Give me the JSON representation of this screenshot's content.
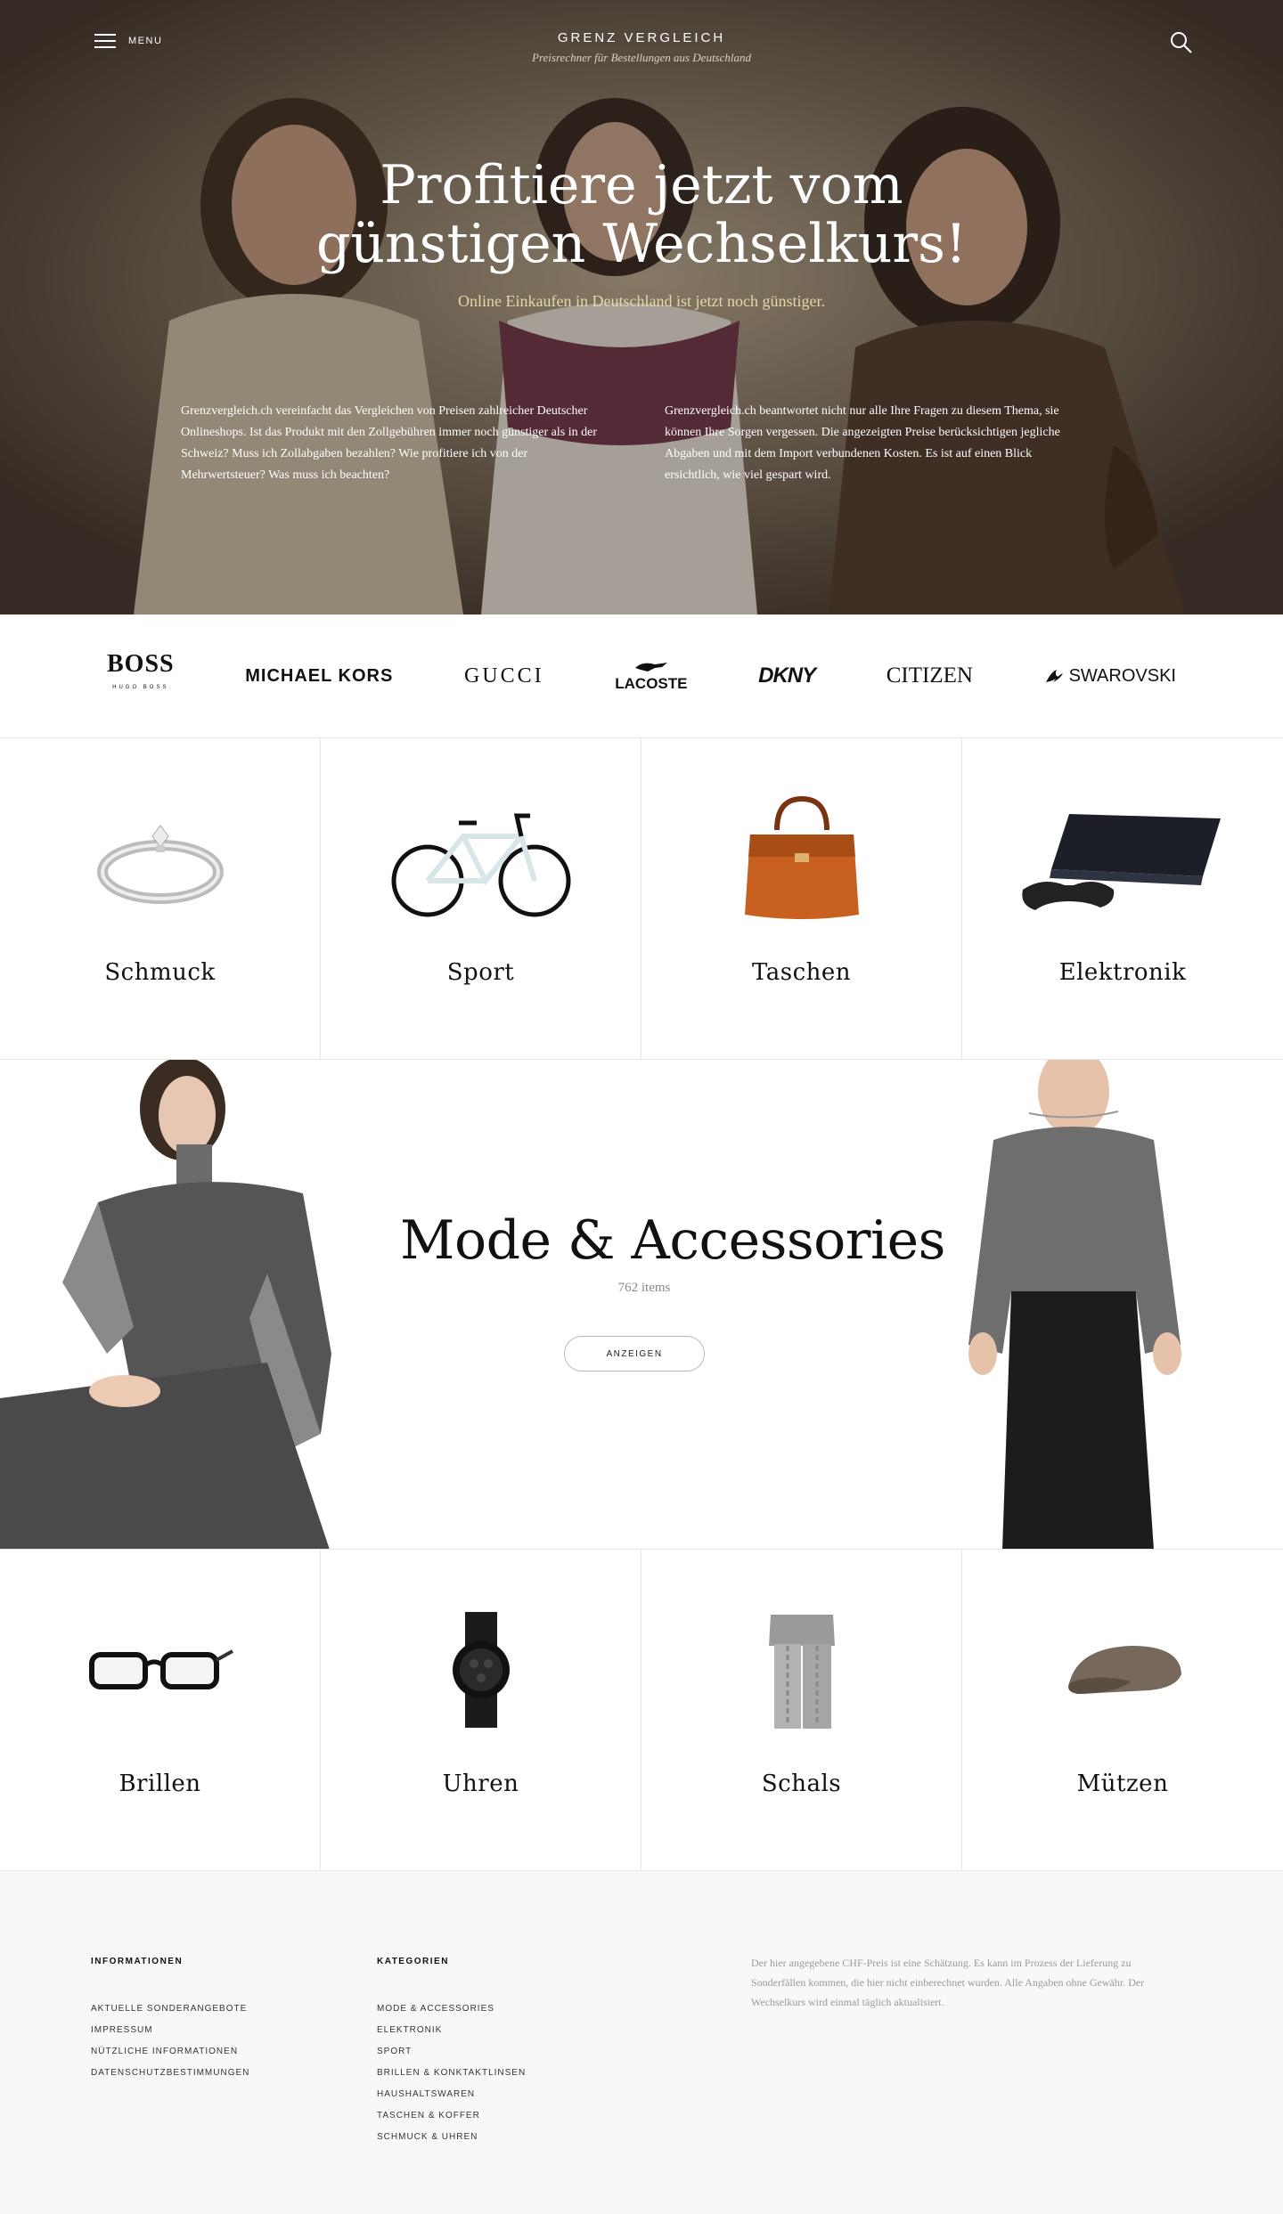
{
  "header": {
    "menu_label": "MENU",
    "brand_title": "GRENZ VERGLEICH",
    "brand_subtitle": "Preisrechner für Bestellungen aus Deutschland"
  },
  "hero": {
    "title_line1": "Profitiere jetzt vom",
    "title_line2": "günstigen Wechselkurs!",
    "subtitle": "Online Einkaufen in Deutschland ist jetzt noch günstiger.",
    "text_left": "Grenzvergleich.ch vereinfacht das Vergleichen von Preisen zahlreicher Deutscher Onlineshops. Ist das Produkt mit den Zollgebühren immer noch günstiger als in der Schweiz? Muss ich Zollabgaben bezahlen? Wie profitiere ich von der Mehrwertsteuer?  Was muss ich beachten?",
    "text_right": "Grenzvergleich.ch beantwortet nicht nur alle Ihre Fragen zu diesem Thema, sie können Ihre Sorgen vergessen. Die angezeigten Preise berücksichtigen jegliche Abgaben und mit dem Import verbundenen Kosten. Es ist auf einen Blick ersichtlich, wie viel gespart wird."
  },
  "brands": {
    "boss": "BOSS",
    "boss_small": "HUGO BOSS",
    "michael_kors": "MICHAEL KORS",
    "gucci": "GUCCI",
    "lacoste": "LACOSTE",
    "dkny": "DKNY",
    "citizen": "CITIZEN",
    "swarovski": "SWAROVSKI"
  },
  "categories_top": [
    {
      "label": "Schmuck",
      "icon": "ring-icon"
    },
    {
      "label": "Sport",
      "icon": "bicycle-icon"
    },
    {
      "label": "Taschen",
      "icon": "bag-icon"
    },
    {
      "label": "Elektronik",
      "icon": "console-icon"
    }
  ],
  "feature": {
    "title": "Mode & Accessories",
    "count": "762 items",
    "button": "ANZEIGEN"
  },
  "categories_bottom": [
    {
      "label": "Brillen",
      "icon": "glasses-icon"
    },
    {
      "label": "Uhren",
      "icon": "watch-icon"
    },
    {
      "label": "Schals",
      "icon": "scarf-icon"
    },
    {
      "label": "Mützen",
      "icon": "cap-icon"
    }
  ],
  "footer": {
    "info_heading": "INFORMATIONEN",
    "info_links": [
      "AKTUELLE SONDERANGEBOTE",
      "IMPRESSUM",
      "NÜTZLICHE INFORMATIONEN",
      "DATENSCHUTZBESTIMMUNGEN"
    ],
    "cat_heading": "KATEGORIEN",
    "cat_links": [
      "MODE & ACCESSORIES",
      "ELEKTRONIK",
      "SPORT",
      "BRILLEN & KONKTAKTLINSEN",
      "HAUSHALTSWAREN",
      "TASCHEN & KOFFER",
      "SCHMUCK & UHREN"
    ],
    "note": "Der hier angegebene CHF-Preis ist eine Schätzung. Es kann im Prozess der Lieferung zu Sonderfällen kommen, die hier nicht einberechnet wurden. Alle Angaben ohne Gewähr. Der Wechselkurs wird einmal täglich aktualisiert."
  },
  "colors": {
    "hero_subtitle": "#e4d7a8",
    "divider": "#e6e6e6",
    "footer_bg": "#f8f8f8"
  }
}
